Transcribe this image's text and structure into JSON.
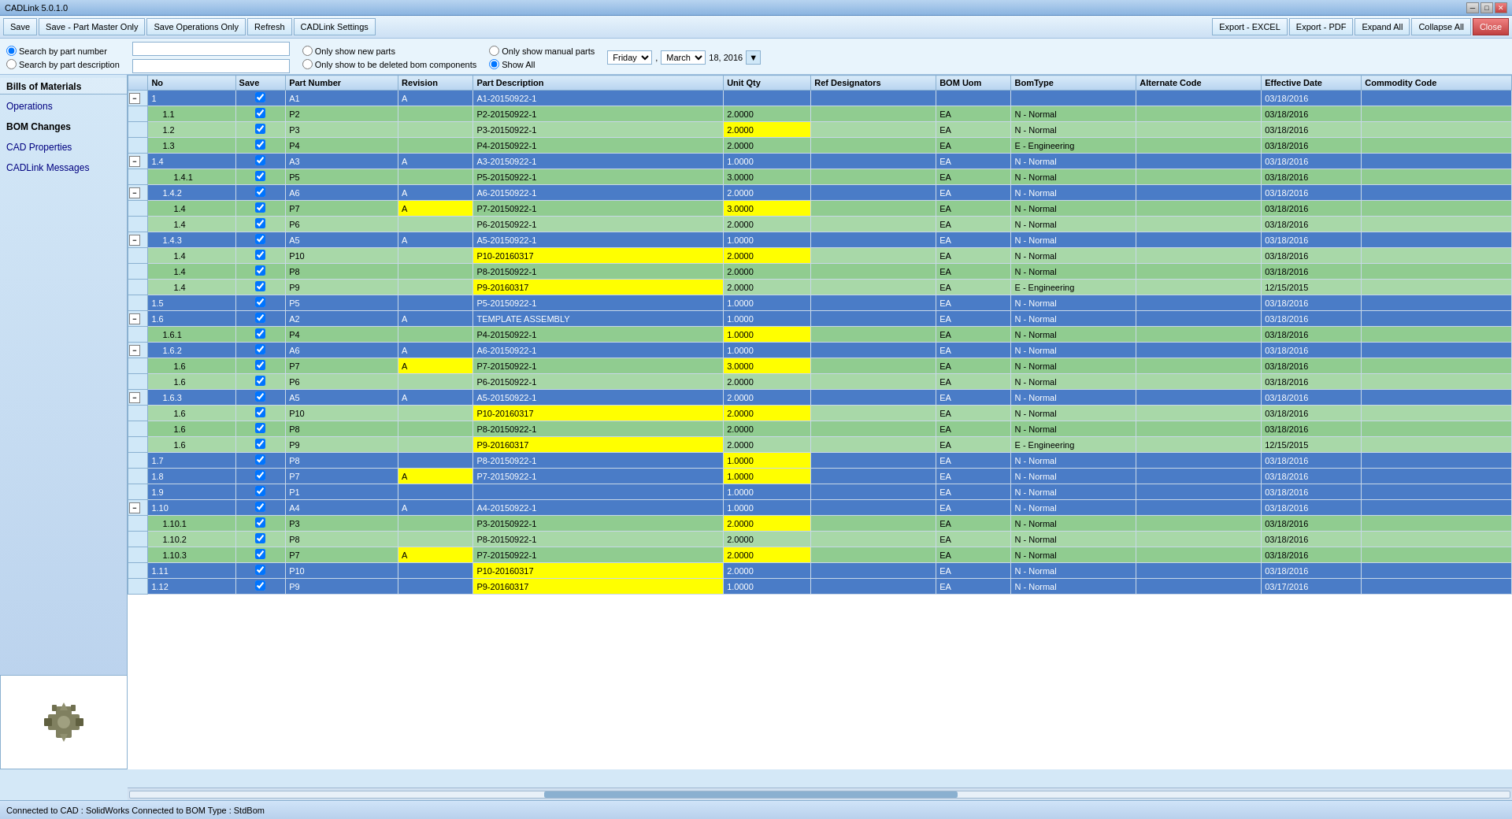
{
  "app": {
    "title": "CADLink 5.0.1.0",
    "status": "Connected to CAD :  SolidWorks   Connected to BOM Type :  StdBom"
  },
  "titlebar": {
    "minimize": "─",
    "maximize": "□",
    "close": "✕"
  },
  "toolbar": {
    "save": "Save",
    "save_part_master": "Save - Part Master Only",
    "save_operations": "Save Operations Only",
    "refresh": "Refresh",
    "cadlink_settings": "CADLink Settings",
    "export_excel": "Export - EXCEL",
    "export_pdf": "Export - PDF",
    "expand_all": "Expand All",
    "collapse_all": "Collapse All",
    "close": "Close"
  },
  "search": {
    "by_part_number_label": "Search by part number",
    "by_part_desc_label": "Search by part description",
    "only_new_parts": "Only show new parts",
    "only_manual_parts": "Only show manual parts",
    "show_all": "Show All",
    "only_deleted": "Only show to be deleted bom components",
    "date_day": "Friday",
    "date_sep1": ",",
    "date_month": "March",
    "date_date": "18, 2016"
  },
  "sidebar": {
    "bills_of_materials": "Bills of Materials",
    "operations": "Operations",
    "bom_changes": "BOM Changes",
    "cad_properties": "CAD Properties",
    "cadlink_messages": "CADLink Messages"
  },
  "table": {
    "columns": [
      "No",
      "Save",
      "Part Number",
      "Revision",
      "Part Description",
      "Unit Qty",
      "Ref Designators",
      "BOM Uom",
      "BomType",
      "Alternate Code",
      "Effective Date",
      "Commodity Code"
    ],
    "col_widths": [
      "70px",
      "40px",
      "90px",
      "60px",
      "200px",
      "70px",
      "80px",
      "60px",
      "100px",
      "100px",
      "80px",
      "100px"
    ],
    "rows": [
      {
        "no": "1",
        "save": true,
        "part": "A1",
        "rev": "A",
        "desc": "A1-20150922-1",
        "qty": "",
        "ref": "",
        "uom": "",
        "btype": "",
        "alt": "",
        "eff": "03/18/2016",
        "comm": "",
        "level": 0,
        "color": "blue",
        "expand": "minus"
      },
      {
        "no": "1.1",
        "save": true,
        "part": "P2",
        "rev": "",
        "desc": "P2-20150922-1",
        "qty": "2.0000",
        "ref": "",
        "uom": "EA",
        "btype": "N - Normal",
        "alt": "",
        "eff": "03/18/2016",
        "comm": "",
        "level": 1,
        "color": "green"
      },
      {
        "no": "1.2",
        "save": true,
        "part": "P3",
        "rev": "",
        "desc": "P3-20150922-1",
        "qty": "2.0000",
        "ref": "",
        "uom": "EA",
        "btype": "N - Normal",
        "alt": "",
        "eff": "03/18/2016",
        "comm": "",
        "level": 1,
        "color": "green",
        "qty_yellow": true
      },
      {
        "no": "1.3",
        "save": true,
        "part": "P4",
        "rev": "",
        "desc": "P4-20150922-1",
        "qty": "2.0000",
        "ref": "",
        "uom": "EA",
        "btype": "E - Engineering",
        "alt": "",
        "eff": "03/18/2016",
        "comm": "",
        "level": 1,
        "color": "green"
      },
      {
        "no": "1.4",
        "save": true,
        "part": "A3",
        "rev": "A",
        "desc": "A3-20150922-1",
        "qty": "1.0000",
        "ref": "",
        "uom": "EA",
        "btype": "N - Normal",
        "alt": "",
        "eff": "03/18/2016",
        "comm": "",
        "level": 0,
        "color": "blue",
        "expand": "minus"
      },
      {
        "no": "1.4.1",
        "save": true,
        "part": "P5",
        "rev": "",
        "desc": "P5-20150922-1",
        "qty": "3.0000",
        "ref": "",
        "uom": "EA",
        "btype": "N - Normal",
        "alt": "",
        "eff": "03/18/2016",
        "comm": "",
        "level": 2,
        "color": "green"
      },
      {
        "no": "1.4.2",
        "save": true,
        "part": "A6",
        "rev": "A",
        "desc": "A6-20150922-1",
        "qty": "2.0000",
        "ref": "",
        "uom": "EA",
        "btype": "N - Normal",
        "alt": "",
        "eff": "03/18/2016",
        "comm": "",
        "level": 1,
        "color": "blue",
        "expand": "minus"
      },
      {
        "no": "1.4",
        "save": true,
        "part": "P7",
        "rev": "A",
        "desc": "P7-20150922-1",
        "qty": "3.0000",
        "ref": "",
        "uom": "EA",
        "btype": "N - Normal",
        "alt": "",
        "eff": "03/18/2016",
        "comm": "",
        "level": 2,
        "color": "green",
        "qty_yellow": true,
        "rev_yellow": true
      },
      {
        "no": "1.4",
        "save": true,
        "part": "P6",
        "rev": "",
        "desc": "P6-20150922-1",
        "qty": "2.0000",
        "ref": "",
        "uom": "EA",
        "btype": "N - Normal",
        "alt": "",
        "eff": "03/18/2016",
        "comm": "",
        "level": 2,
        "color": "green"
      },
      {
        "no": "1.4.3",
        "save": true,
        "part": "A5",
        "rev": "A",
        "desc": "A5-20150922-1",
        "qty": "1.0000",
        "ref": "",
        "uom": "EA",
        "btype": "N - Normal",
        "alt": "",
        "eff": "03/18/2016",
        "comm": "",
        "level": 1,
        "color": "blue",
        "expand": "minus"
      },
      {
        "no": "1.4",
        "save": true,
        "part": "P10",
        "rev": "",
        "desc": "P10-20160317",
        "qty": "2.0000",
        "ref": "",
        "uom": "EA",
        "btype": "N - Normal",
        "alt": "",
        "eff": "03/18/2016",
        "comm": "",
        "level": 2,
        "color": "green",
        "desc_yellow": true,
        "qty_yellow": true
      },
      {
        "no": "1.4",
        "save": true,
        "part": "P8",
        "rev": "",
        "desc": "P8-20150922-1",
        "qty": "2.0000",
        "ref": "",
        "uom": "EA",
        "btype": "N - Normal",
        "alt": "",
        "eff": "03/18/2016",
        "comm": "",
        "level": 2,
        "color": "green"
      },
      {
        "no": "1.4",
        "save": true,
        "part": "P9",
        "rev": "",
        "desc": "P9-20160317",
        "qty": "2.0000",
        "ref": "",
        "uom": "EA",
        "btype": "E - Engineering",
        "alt": "",
        "eff": "12/15/2015",
        "comm": "",
        "level": 2,
        "color": "green",
        "desc_yellow": true
      },
      {
        "no": "1.5",
        "save": true,
        "part": "P5",
        "rev": "",
        "desc": "P5-20150922-1",
        "qty": "1.0000",
        "ref": "",
        "uom": "EA",
        "btype": "N - Normal",
        "alt": "",
        "eff": "03/18/2016",
        "comm": "",
        "level": 0,
        "color": "blue"
      },
      {
        "no": "1.6",
        "save": true,
        "part": "A2",
        "rev": "A",
        "desc": "TEMPLATE ASSEMBLY",
        "qty": "1.0000",
        "ref": "",
        "uom": "EA",
        "btype": "N - Normal",
        "alt": "",
        "eff": "03/18/2016",
        "comm": "",
        "level": 0,
        "color": "blue",
        "expand": "minus"
      },
      {
        "no": "1.6.1",
        "save": true,
        "part": "P4",
        "rev": "",
        "desc": "P4-20150922-1",
        "qty": "1.0000",
        "ref": "",
        "uom": "EA",
        "btype": "N - Normal",
        "alt": "",
        "eff": "03/18/2016",
        "comm": "",
        "level": 1,
        "color": "green",
        "qty_yellow": true
      },
      {
        "no": "1.6.2",
        "save": true,
        "part": "A6",
        "rev": "A",
        "desc": "A6-20150922-1",
        "qty": "1.0000",
        "ref": "",
        "uom": "EA",
        "btype": "N - Normal",
        "alt": "",
        "eff": "03/18/2016",
        "comm": "",
        "level": 1,
        "color": "blue",
        "expand": "minus"
      },
      {
        "no": "1.6",
        "save": true,
        "part": "P7",
        "rev": "A",
        "desc": "P7-20150922-1",
        "qty": "3.0000",
        "ref": "",
        "uom": "EA",
        "btype": "N - Normal",
        "alt": "",
        "eff": "03/18/2016",
        "comm": "",
        "level": 2,
        "color": "green",
        "qty_yellow": true,
        "rev_yellow": true
      },
      {
        "no": "1.6",
        "save": true,
        "part": "P6",
        "rev": "",
        "desc": "P6-20150922-1",
        "qty": "2.0000",
        "ref": "",
        "uom": "EA",
        "btype": "N - Normal",
        "alt": "",
        "eff": "03/18/2016",
        "comm": "",
        "level": 2,
        "color": "green"
      },
      {
        "no": "1.6.3",
        "save": true,
        "part": "A5",
        "rev": "A",
        "desc": "A5-20150922-1",
        "qty": "2.0000",
        "ref": "",
        "uom": "EA",
        "btype": "N - Normal",
        "alt": "",
        "eff": "03/18/2016",
        "comm": "",
        "level": 1,
        "color": "blue",
        "expand": "minus"
      },
      {
        "no": "1.6",
        "save": true,
        "part": "P10",
        "rev": "",
        "desc": "P10-20160317",
        "qty": "2.0000",
        "ref": "",
        "uom": "EA",
        "btype": "N - Normal",
        "alt": "",
        "eff": "03/18/2016",
        "comm": "",
        "level": 2,
        "color": "green",
        "desc_yellow": true,
        "qty_yellow": true
      },
      {
        "no": "1.6",
        "save": true,
        "part": "P8",
        "rev": "",
        "desc": "P8-20150922-1",
        "qty": "2.0000",
        "ref": "",
        "uom": "EA",
        "btype": "N - Normal",
        "alt": "",
        "eff": "03/18/2016",
        "comm": "",
        "level": 2,
        "color": "green"
      },
      {
        "no": "1.6",
        "save": true,
        "part": "P9",
        "rev": "",
        "desc": "P9-20160317",
        "qty": "2.0000",
        "ref": "",
        "uom": "EA",
        "btype": "E - Engineering",
        "alt": "",
        "eff": "12/15/2015",
        "comm": "",
        "level": 2,
        "color": "green",
        "desc_yellow": true
      },
      {
        "no": "1.7",
        "save": true,
        "part": "P8",
        "rev": "",
        "desc": "P8-20150922-1",
        "qty": "1.0000",
        "ref": "",
        "uom": "EA",
        "btype": "N - Normal",
        "alt": "",
        "eff": "03/18/2016",
        "comm": "",
        "level": 0,
        "color": "blue",
        "qty_yellow": true
      },
      {
        "no": "1.8",
        "save": true,
        "part": "P7",
        "rev": "A",
        "desc": "P7-20150922-1",
        "qty": "1.0000",
        "ref": "",
        "uom": "EA",
        "btype": "N - Normal",
        "alt": "",
        "eff": "03/18/2016",
        "comm": "",
        "level": 0,
        "color": "blue",
        "qty_yellow": true,
        "rev_yellow": true
      },
      {
        "no": "1.9",
        "save": true,
        "part": "P1",
        "rev": "",
        "desc": "",
        "qty": "1.0000",
        "ref": "",
        "uom": "EA",
        "btype": "N - Normal",
        "alt": "",
        "eff": "03/18/2016",
        "comm": "",
        "level": 0,
        "color": "blue"
      },
      {
        "no": "1.10",
        "save": true,
        "part": "A4",
        "rev": "A",
        "desc": "A4-20150922-1",
        "qty": "1.0000",
        "ref": "",
        "uom": "EA",
        "btype": "N - Normal",
        "alt": "",
        "eff": "03/18/2016",
        "comm": "",
        "level": 0,
        "color": "blue",
        "expand": "minus"
      },
      {
        "no": "1.10.1",
        "save": true,
        "part": "P3",
        "rev": "",
        "desc": "P3-20150922-1",
        "qty": "2.0000",
        "ref": "",
        "uom": "EA",
        "btype": "N - Normal",
        "alt": "",
        "eff": "03/18/2016",
        "comm": "",
        "level": 1,
        "color": "green",
        "qty_yellow": true
      },
      {
        "no": "1.10.2",
        "save": true,
        "part": "P8",
        "rev": "",
        "desc": "P8-20150922-1",
        "qty": "2.0000",
        "ref": "",
        "uom": "EA",
        "btype": "N - Normal",
        "alt": "",
        "eff": "03/18/2016",
        "comm": "",
        "level": 1,
        "color": "green"
      },
      {
        "no": "1.10.3",
        "save": true,
        "part": "P7",
        "rev": "A",
        "desc": "P7-20150922-1",
        "qty": "2.0000",
        "ref": "",
        "uom": "EA",
        "btype": "N - Normal",
        "alt": "",
        "eff": "03/18/2016",
        "comm": "",
        "level": 1,
        "color": "green",
        "qty_yellow": true,
        "rev_yellow": true
      },
      {
        "no": "1.11",
        "save": true,
        "part": "P10",
        "rev": "",
        "desc": "P10-20160317",
        "qty": "2.0000",
        "ref": "",
        "uom": "EA",
        "btype": "N - Normal",
        "alt": "",
        "eff": "03/18/2016",
        "comm": "",
        "level": 0,
        "color": "blue",
        "desc_yellow": true
      },
      {
        "no": "1.12",
        "save": true,
        "part": "P9",
        "rev": "",
        "desc": "P9-20160317",
        "qty": "1.0000",
        "ref": "",
        "uom": "EA",
        "btype": "N - Normal",
        "alt": "",
        "eff": "03/17/2016",
        "comm": "",
        "level": 0,
        "color": "blue",
        "desc_yellow": true
      }
    ]
  }
}
